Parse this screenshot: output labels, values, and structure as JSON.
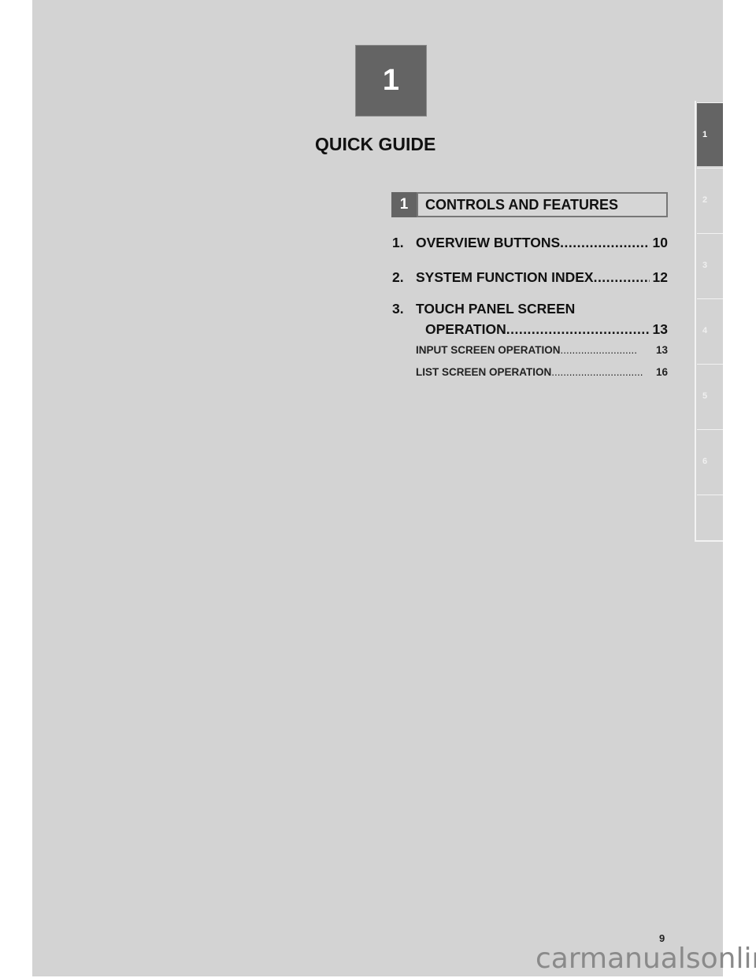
{
  "chapter": {
    "number": "1",
    "title": "QUICK GUIDE"
  },
  "section": {
    "number": "1",
    "title": "CONTROLS AND FEATURES"
  },
  "toc": [
    {
      "num": "1.",
      "text": "OVERVIEW BUTTONS",
      "dots": "..................................",
      "page": "10"
    },
    {
      "num": "2.",
      "text": "SYSTEM FUNCTION INDEX",
      "dots": ".........................",
      "page": "12"
    },
    {
      "num": "3.",
      "text": "TOUCH PANEL SCREEN",
      "text2": "OPERATION",
      "dots": "..........................................",
      "page": "13"
    }
  ],
  "subitems": [
    {
      "text": "INPUT SCREEN OPERATION",
      "dots": "..........................",
      "page": "13"
    },
    {
      "text": "LIST SCREEN OPERATION",
      "dots": "...............................",
      "page": "16"
    }
  ],
  "tabs": [
    {
      "label": "1",
      "active": true
    },
    {
      "label": "2",
      "active": false
    },
    {
      "label": "3",
      "active": false
    },
    {
      "label": "4",
      "active": false
    },
    {
      "label": "5",
      "active": false
    },
    {
      "label": "6",
      "active": false
    },
    {
      "label": "",
      "active": false
    }
  ],
  "page_number": "9",
  "watermark": "carmanualsonline.info"
}
